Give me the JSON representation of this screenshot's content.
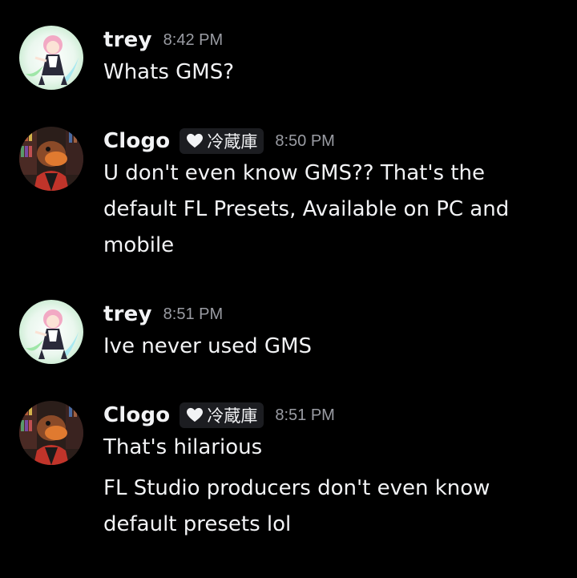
{
  "colors": {
    "background": "#000000",
    "text": "#f2f3f5",
    "timestamp": "#9a9ca3",
    "tag_background": "#1c1d21"
  },
  "messages": [
    {
      "author": "trey",
      "avatar": "anime-girl-avatar",
      "time": "8:42 PM",
      "lines": [
        "Whats GMS?"
      ]
    },
    {
      "author": "Clogo",
      "avatar": "cartoon-character-avatar",
      "tag": "冷蔵庫",
      "tag_icon": "heart-icon",
      "time": "8:50 PM",
      "lines": [
        "U don't even know GMS?? That's the default FL Presets, Available on PC and mobile"
      ]
    },
    {
      "author": "trey",
      "avatar": "anime-girl-avatar",
      "time": "8:51 PM",
      "lines": [
        "Ive never used GMS"
      ]
    },
    {
      "author": "Clogo",
      "avatar": "cartoon-character-avatar",
      "tag": "冷蔵庫",
      "tag_icon": "heart-icon",
      "time": "8:51 PM",
      "lines": [
        "That's hilarious",
        "FL Studio producers don't even know default presets lol"
      ]
    }
  ]
}
